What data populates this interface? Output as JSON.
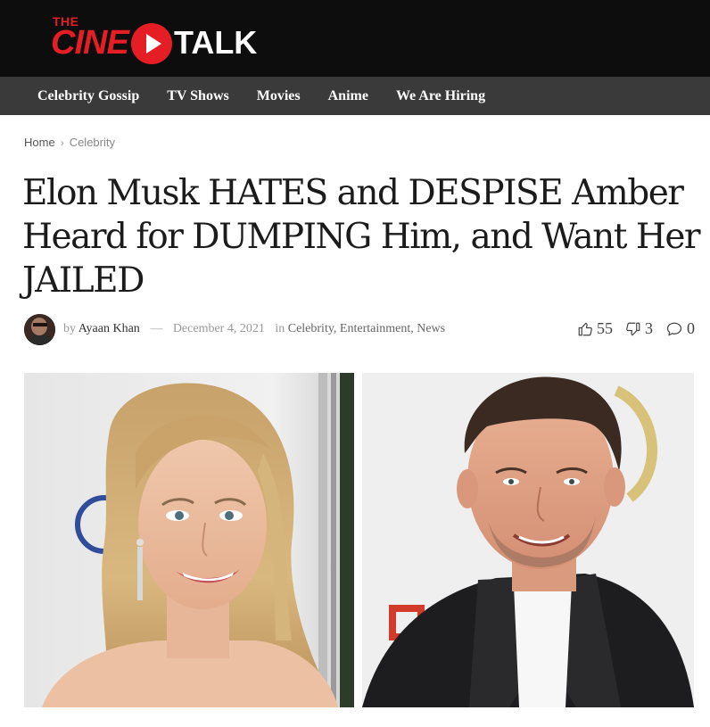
{
  "site": {
    "logo_the": "THE",
    "logo_cine": "CINE",
    "logo_talk": "TALK"
  },
  "nav": {
    "items": [
      {
        "label": "Celebrity Gossip"
      },
      {
        "label": "TV Shows"
      },
      {
        "label": "Movies"
      },
      {
        "label": "Anime"
      },
      {
        "label": "We Are Hiring"
      }
    ]
  },
  "breadcrumb": {
    "home": "Home",
    "separator": "›",
    "category": "Celebrity"
  },
  "article": {
    "title": "Elon Musk HATES and DESPISE Amber Heard for DUMPING Him, and Want Her JAILED",
    "by": "by",
    "author": "Ayaan Khan",
    "dash": "—",
    "date": "December 4, 2021",
    "in": "in",
    "categories": [
      "Celebrity",
      "Entertainment",
      "News"
    ],
    "likes": "55",
    "dislikes": "3",
    "comments": "0"
  },
  "colors": {
    "brand_red": "#e51d25",
    "header_bg": "#0d0d0d",
    "nav_bg": "#3a3a3a"
  },
  "icons": {
    "like": "thumbs-up-icon",
    "dislike": "thumbs-down-icon",
    "comment": "comment-bubble-icon"
  }
}
